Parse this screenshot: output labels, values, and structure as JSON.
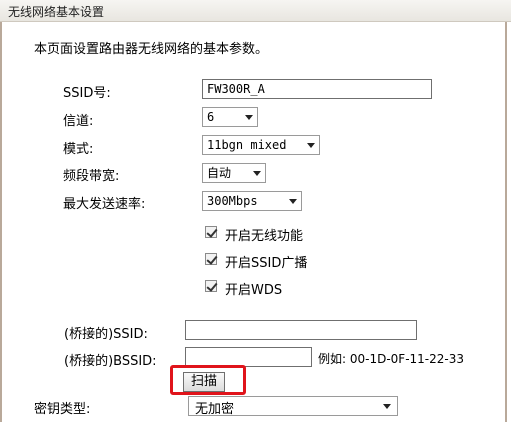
{
  "window": {
    "title": "无线网络基本设置"
  },
  "description": "本页面设置路由器无线网络的基本参数。",
  "fields": {
    "ssid": {
      "label": "SSID号:",
      "value": "FW300R_A"
    },
    "channel": {
      "label": "信道:",
      "value": "6"
    },
    "mode": {
      "label": "模式:",
      "value": "11bgn mixed"
    },
    "bandwidth": {
      "label": "频段带宽:",
      "value": "自动"
    },
    "max_rate": {
      "label": "最大发送速率:",
      "value": "300Mbps"
    }
  },
  "checkboxes": {
    "enable_wireless": {
      "label": "开启无线功能",
      "checked": true
    },
    "enable_ssid_broadcast": {
      "label": "开启SSID广播",
      "checked": true
    },
    "enable_wds": {
      "label": "开启WDS",
      "checked": true
    }
  },
  "wds": {
    "bridged_ssid_label": "(桥接的)SSID:",
    "bridged_ssid_value": "",
    "bridged_bssid_label": "(桥接的)BSSID:",
    "bridged_bssid_value": "",
    "example": "例如: 00-1D-0F-11-22-33",
    "scan_label": "扫描"
  },
  "key": {
    "type_label": "密钥类型:",
    "type_value": "无加密"
  },
  "colors": {
    "highlight": "#e0141b",
    "frame": "#b9a99a"
  }
}
